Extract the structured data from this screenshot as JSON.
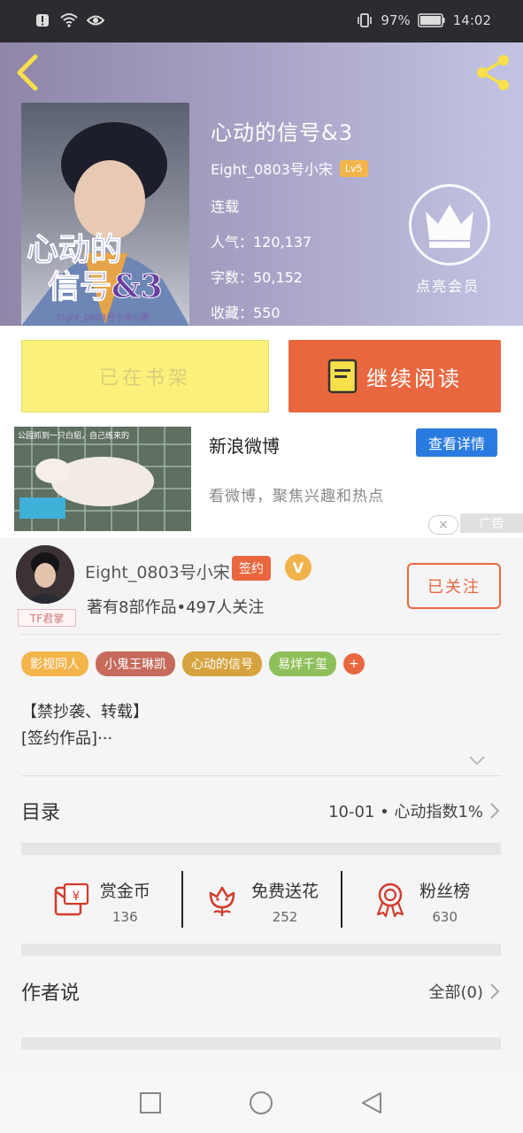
{
  "status_bar": {
    "battery": "97%",
    "time": "14:02",
    "icons": [
      "alert-icon",
      "wifi-icon",
      "eye-icon",
      "vibrate-icon",
      "battery-icon"
    ]
  },
  "book": {
    "title": "心动的信号&3",
    "author": "Eight_0803号小宋",
    "level": "Lv5",
    "status": "连载",
    "popularity": "人气：120,137",
    "word_count": "字数：50,152",
    "favorites": "收藏：550",
    "cover_text_line1": "心动的",
    "cover_text_line2": "信号&3",
    "cover_author": "Eight_0803号小宋◎著",
    "vip_label": "点亮会员"
  },
  "actions": {
    "shelf": "已在书架",
    "read": "继续阅读"
  },
  "ad": {
    "title": "新浪微博",
    "button": "查看详情",
    "subtitle": "看微博，聚焦兴趣和热点",
    "image_caption": "公园抓到一只白貂，自己练来的",
    "tag": "广告",
    "close": "×"
  },
  "author": {
    "name": "Eight_0803号小宋",
    "sign": "签约",
    "v": "V",
    "stats": "著有8部作品•497人关注",
    "badge": "TF君掌",
    "follow": "已关注"
  },
  "tags": [
    {
      "label": "影视同人",
      "color": "#f3b44a"
    },
    {
      "label": "小鬼王琳凯",
      "color": "#c66b5c"
    },
    {
      "label": "心动的信号",
      "color": "#d7a33e"
    },
    {
      "label": "易烊千玺",
      "color": "#8fbf5a"
    }
  ],
  "tags_more": "+",
  "description": {
    "line1": "【禁抄袭、转载】",
    "line2": "[签约作品]···"
  },
  "catalog": {
    "label": "目录",
    "value": "10-01 • 心动指数1%"
  },
  "stats": [
    {
      "label": "赏金币",
      "value": "136",
      "icon": "red-envelope-icon"
    },
    {
      "label": "免费送花",
      "value": "252",
      "icon": "flower-icon"
    },
    {
      "label": "粉丝榜",
      "value": "630",
      "icon": "medal-icon"
    }
  ],
  "author_says": {
    "label": "作者说",
    "value": "全部(0)"
  },
  "colors": {
    "accent": "#e9673f",
    "shelf_yellow": "#fbf07a",
    "ad_blue": "#2a7be0"
  }
}
